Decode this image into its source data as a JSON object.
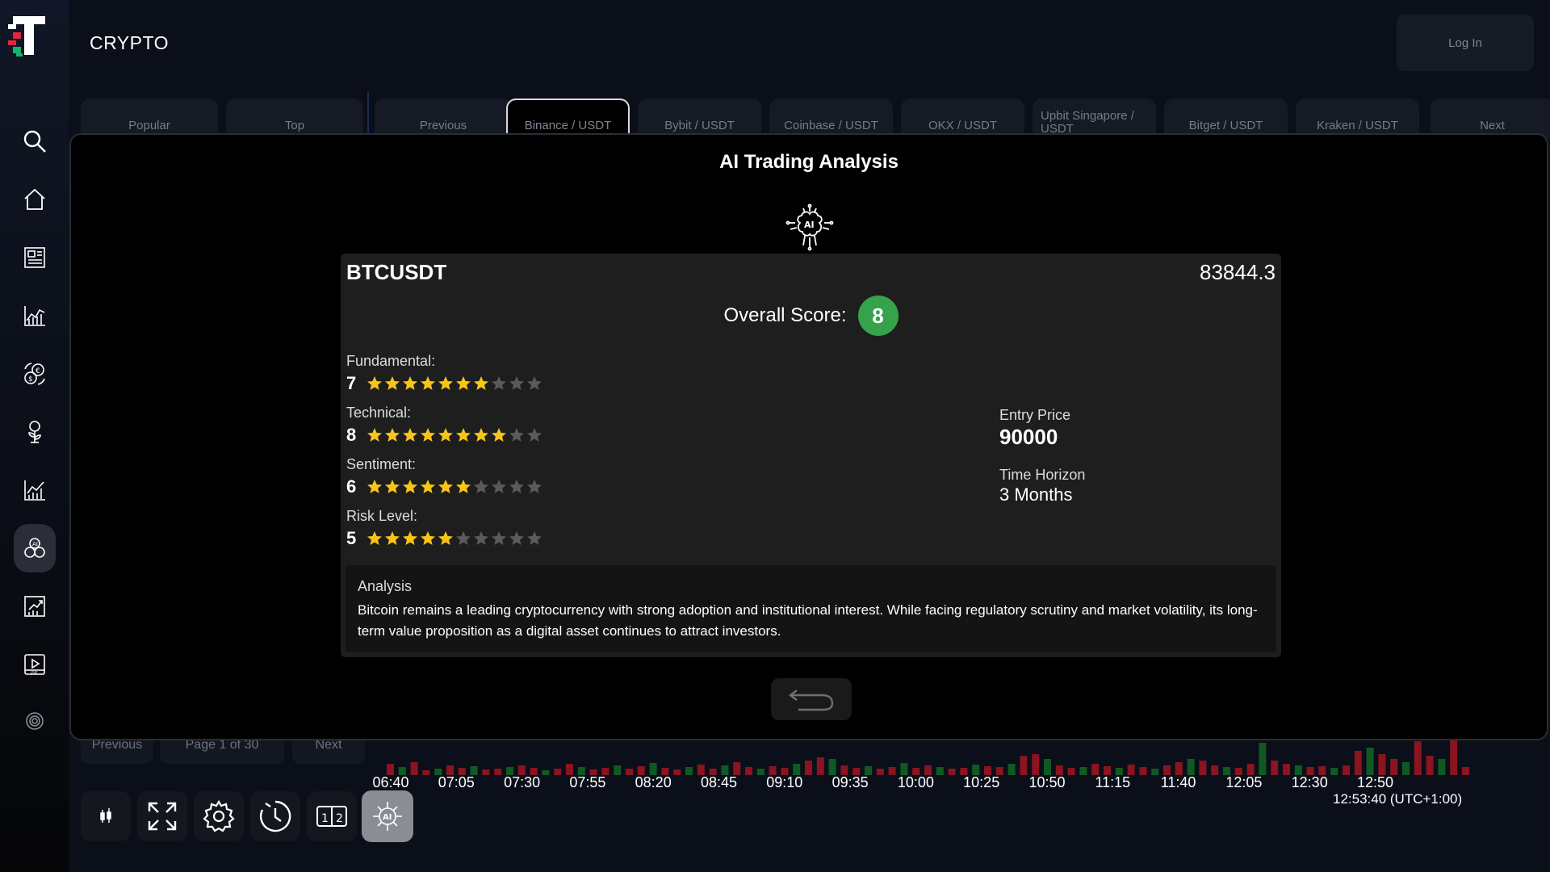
{
  "header": {
    "brand": "CRYPTO",
    "login_label": "Log In"
  },
  "sidebar": {
    "items": [
      {
        "icon": "search-icon"
      },
      {
        "icon": "home-icon"
      },
      {
        "icon": "news-icon"
      },
      {
        "icon": "chart-icon"
      },
      {
        "icon": "exchange-icon"
      },
      {
        "icon": "plant-money-icon"
      },
      {
        "icon": "stats-icon"
      },
      {
        "icon": "ai-coins-icon",
        "active": true
      },
      {
        "icon": "growth-chart-icon"
      },
      {
        "icon": "live-video-icon"
      },
      {
        "icon": "settings-ring-icon"
      }
    ]
  },
  "tabs": [
    {
      "label": "Popular"
    },
    {
      "label": "Top"
    },
    {
      "label": "Previous"
    },
    {
      "label": "Binance / USDT",
      "active": true
    },
    {
      "label": "Bybit / USDT"
    },
    {
      "label": "Coinbase / USDT"
    },
    {
      "label": "OKX / USDT"
    },
    {
      "label": "Upbit Singapore / USDT"
    },
    {
      "label": "Bitget / USDT"
    },
    {
      "label": "Kraken / USDT"
    },
    {
      "label": "Next"
    }
  ],
  "modal": {
    "title": "AI Trading Analysis",
    "ai_badge_text": "AI",
    "symbol": "BTCUSDT",
    "price": "83844.3",
    "overall_label": "Overall Score:",
    "overall_score": "8",
    "score_color": "#36a24b",
    "metrics": [
      {
        "label": "Fundamental:",
        "value": "7",
        "stars": 7
      },
      {
        "label": "Technical:",
        "value": "8",
        "stars": 8
      },
      {
        "label": "Sentiment:",
        "value": "6",
        "stars": 6
      },
      {
        "label": "Risk Level:",
        "value": "5",
        "stars": 5
      }
    ],
    "entry_price_label": "Entry Price",
    "entry_price": "90000",
    "time_horizon_label": "Time Horizon",
    "time_horizon": "3 Months",
    "analysis_title": "Analysis",
    "analysis_text": "Bitcoin remains a leading cryptocurrency with strong adoption and institutional interest. While facing regulatory scrutiny and market volatility, its long-term value proposition as a digital asset continues to attract investors."
  },
  "pagination": {
    "previous": "Previous",
    "page": "Page 1 of 30",
    "next": "Next"
  },
  "timeline": {
    "labels": [
      "06:40",
      "07:05",
      "07:30",
      "07:55",
      "08:20",
      "08:45",
      "09:10",
      "09:35",
      "10:00",
      "10:25",
      "10:50",
      "11:15",
      "11:40",
      "12:05",
      "12:30",
      "12:50"
    ],
    "clock": "12:53:40 (UTC+1:00)"
  },
  "toolbar": {
    "items": [
      {
        "icon": "candlestick-icon"
      },
      {
        "icon": "fullscreen-icon"
      },
      {
        "icon": "settings-icon"
      },
      {
        "icon": "history-icon"
      },
      {
        "icon": "split-view-icon"
      },
      {
        "icon": "ai-brain-icon",
        "active": true
      }
    ]
  },
  "colors": {
    "star_filled": "#f5c518",
    "star_empty": "#5a5a5a",
    "up_bar": "#0f5a23",
    "down_bar": "#8a1420"
  }
}
